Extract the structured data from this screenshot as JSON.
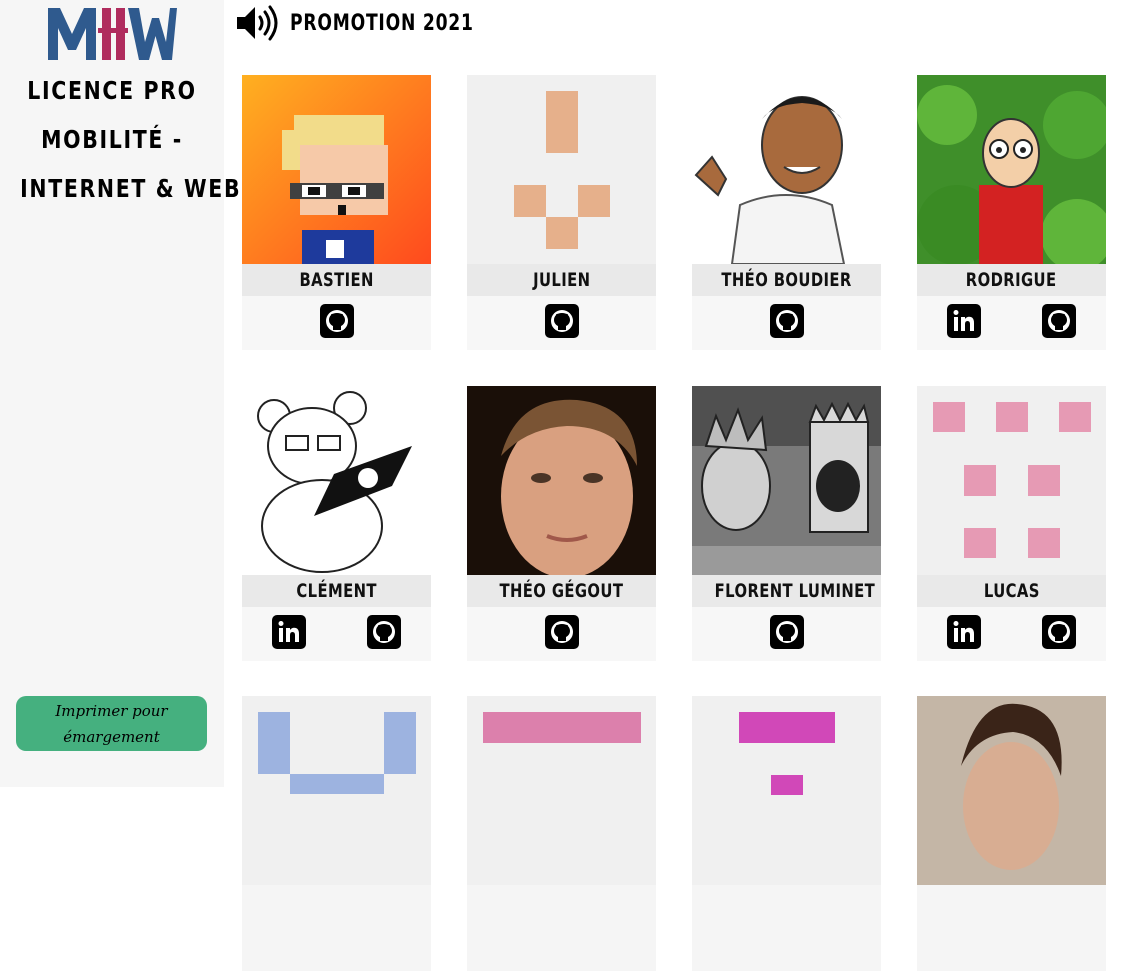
{
  "sidebar": {
    "logo_text": "MIW",
    "subtitle_lines": [
      "LICENCE PRO",
      "MOBILITÉ -",
      "INTERNET & WEB"
    ],
    "print_button_label": "Imprimer pour émargement"
  },
  "header": {
    "icon": "speaker-icon",
    "title": "PROMOTION 2021"
  },
  "students": [
    {
      "name": "BASTIEN",
      "links": [
        "github"
      ]
    },
    {
      "name": "JULIEN",
      "links": [
        "github"
      ]
    },
    {
      "name": "THÉO BOUDIER",
      "links": [
        "github"
      ]
    },
    {
      "name": "RODRIGUE",
      "links": [
        "linkedin",
        "github"
      ]
    },
    {
      "name": "CLÉMENT",
      "links": [
        "linkedin",
        "github"
      ]
    },
    {
      "name": "THÉO GÉGOUT",
      "links": [
        "github"
      ]
    },
    {
      "name": "FLORENT LUMINET",
      "links": [
        "github"
      ]
    },
    {
      "name": "LUCAS",
      "links": [
        "linkedin",
        "github"
      ]
    },
    {
      "name": "",
      "links": []
    },
    {
      "name": "",
      "links": []
    },
    {
      "name": "",
      "links": []
    },
    {
      "name": "",
      "links": []
    }
  ],
  "colors": {
    "logo_blue": "#2f5a8e",
    "logo_pink": "#b02c5e",
    "print_button": "#45b07f",
    "sidebar_bg": "#f6f6f6"
  }
}
